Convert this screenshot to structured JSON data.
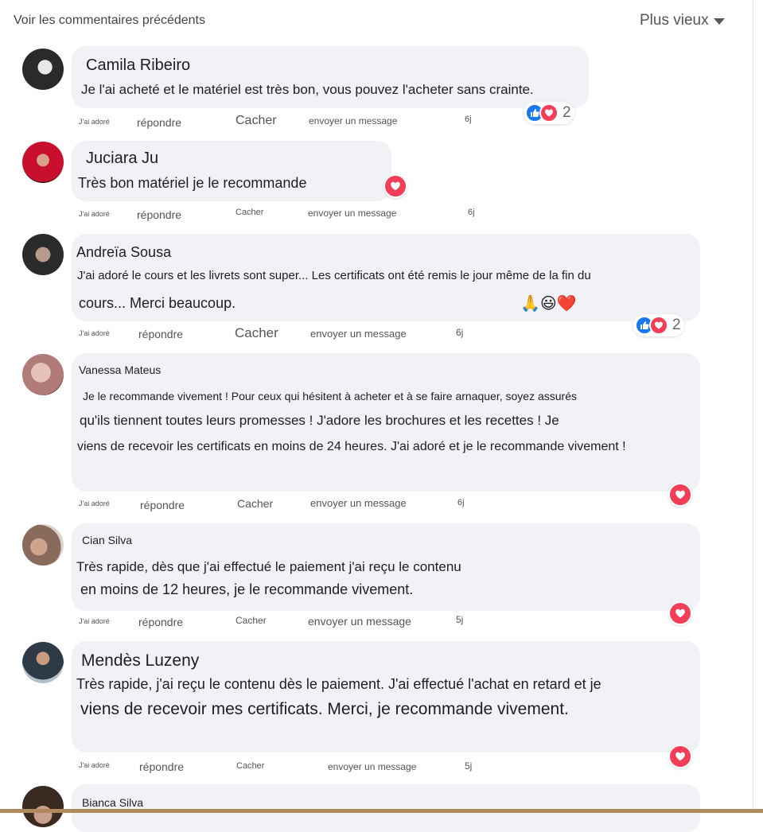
{
  "header": {
    "previous_comments": "Voir les commentaires précédents",
    "sort_label": "Plus vieux"
  },
  "colors": {
    "like_blue": "#1877f2",
    "love_red": "#f33e58",
    "bubble_bg": "#f0f2f5"
  },
  "comments": [
    {
      "author": "Camila Ribeiro",
      "lines": [
        "Je l'ai acheté et le matériel est très bon, vous pouvez l'acheter sans crainte."
      ],
      "actions": {
        "like": "J'ai adoré",
        "reply": "répondre",
        "hide": "Cacher",
        "message": "envoyer un message",
        "time": "6j"
      },
      "reaction_count": "2"
    },
    {
      "author": "Juciara Ju",
      "lines": [
        "Très bon matériel je le recommande"
      ],
      "actions": {
        "like": "J'ai adoré",
        "reply": "répondre",
        "hide": "Cacher",
        "message": "envoyer un message",
        "time": "6j"
      }
    },
    {
      "author": "Andreïa Sousa",
      "lines": [
        "J'ai adoré le cours et les livrets sont super... Les certificats ont été remis le jour même de la fin du",
        "cours... Merci beaucoup."
      ],
      "emojis": "🙏😃❤️",
      "actions": {
        "like": "J'ai adoré",
        "reply": "répondre",
        "hide": "Cacher",
        "message": "envoyer un message",
        "time": "6j"
      },
      "reaction_count": "2"
    },
    {
      "author": "Vanessa Mateus",
      "lines": [
        "Je le recommande vivement ! Pour ceux qui hésitent à acheter et à se faire arnaquer, soyez assurés",
        "qu'ils tiennent toutes leurs promesses ! J'adore les brochures et les recettes ! Je",
        "viens de recevoir les certificats en moins de 24 heures. J'ai adoré et je le recommande vivement !"
      ],
      "actions": {
        "like": "J'ai adoré",
        "reply": "répondre",
        "hide": "Cacher",
        "message": "envoyer un message",
        "time": "6j"
      }
    },
    {
      "author": "Cian Silva",
      "lines": [
        "Très rapide, dès que j'ai effectué le paiement j'ai reçu le contenu",
        "en moins de 12 heures, je le recommande vivement."
      ],
      "actions": {
        "like": "J'ai adoré",
        "reply": "répondre",
        "hide": "Cacher",
        "message": "envoyer un message",
        "time": "5j"
      }
    },
    {
      "author": "Mendès Luzeny",
      "lines": [
        "Très rapide, j'ai reçu le contenu dès le paiement. J'ai effectué l'achat en retard et je",
        "viens de recevoir mes certificats. Merci, je recommande vivement."
      ],
      "actions": {
        "like": "J'ai adoré",
        "reply": "répondre",
        "hide": "Cacher",
        "message": "envoyer un message",
        "time": "5j"
      }
    },
    {
      "author": "Bianca Silva"
    }
  ]
}
